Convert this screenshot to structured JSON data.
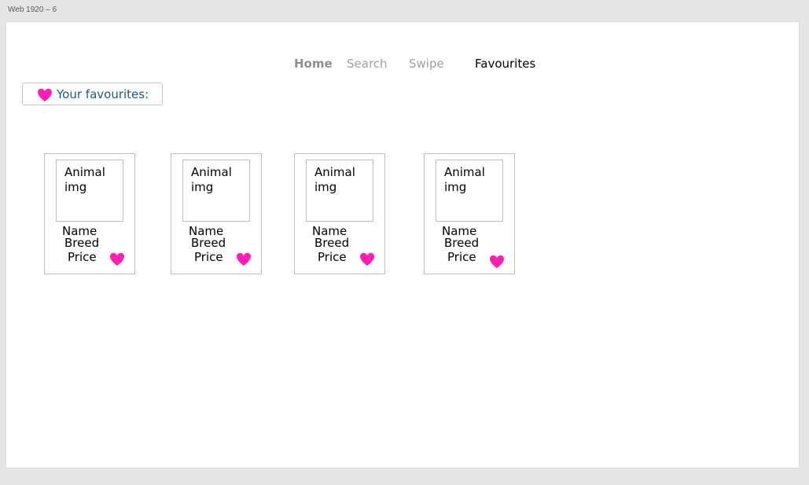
{
  "frame": {
    "label": "Web 1920 – 6"
  },
  "nav": {
    "items": [
      {
        "label": "Home"
      },
      {
        "label": "Search"
      },
      {
        "label": "Swipe"
      },
      {
        "label": "Favourites"
      }
    ]
  },
  "favourites_header": {
    "title": "Your favourites:",
    "icon": "heart-icon"
  },
  "cards": [
    {
      "image_label": "Animal img",
      "name": "Name",
      "breed": "Breed",
      "price": "Price",
      "icon": "heart-icon"
    },
    {
      "image_label": "Animal img",
      "name": "Name",
      "breed": "Breed",
      "price": "Price",
      "icon": "heart-icon"
    },
    {
      "image_label": "Animal img",
      "name": "Name",
      "breed": "Breed",
      "price": "Price",
      "icon": "heart-icon"
    },
    {
      "image_label": "Animal img",
      "name": "Name",
      "breed": "Breed",
      "price": "Price",
      "icon": "heart-icon"
    }
  ],
  "colors": {
    "heart": "#ff1fb4",
    "header_text": "#1a5a78",
    "nav_active": "#000000",
    "nav_inactive": "#a0a0a0"
  }
}
